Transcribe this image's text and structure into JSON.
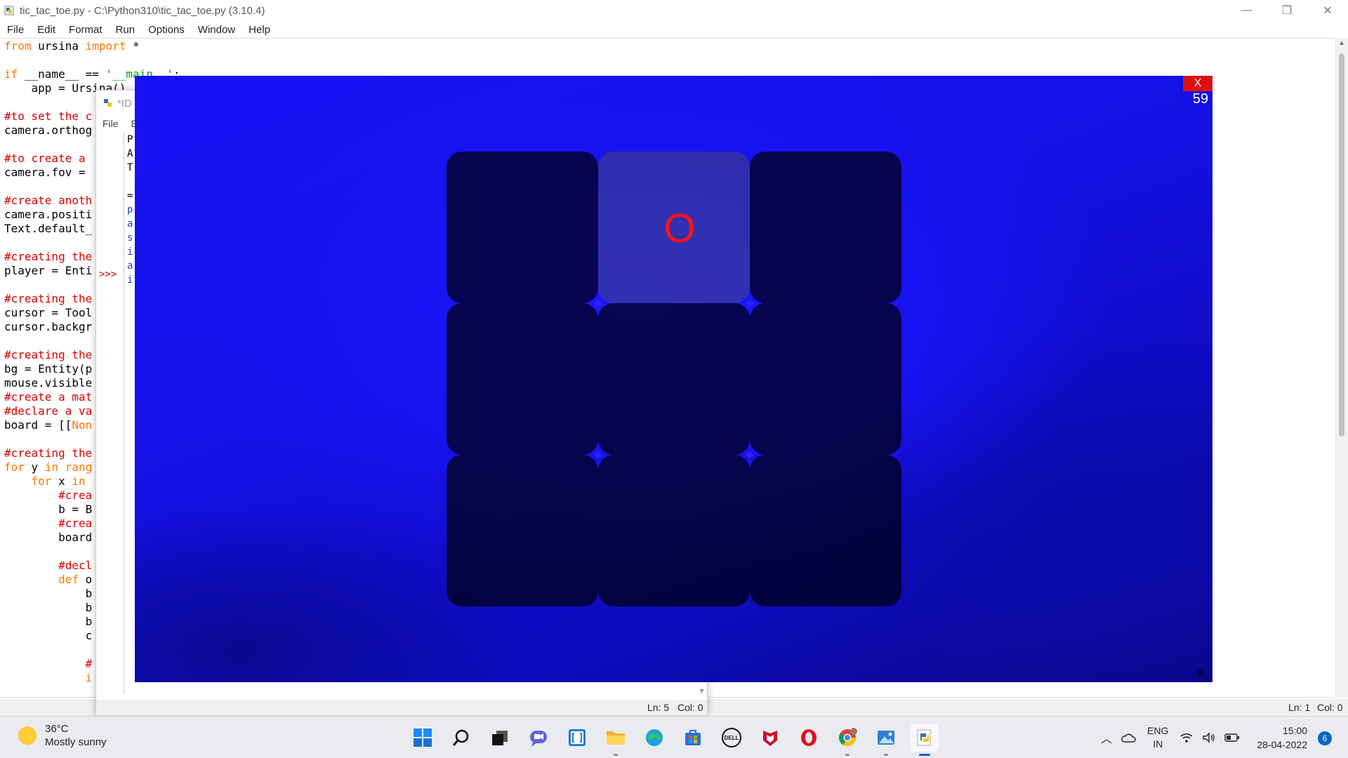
{
  "editor": {
    "title": "tic_tac_toe.py - C:\\Python310\\tic_tac_toe.py (3.10.4)",
    "menu": [
      "File",
      "Edit",
      "Format",
      "Run",
      "Options",
      "Window",
      "Help"
    ],
    "controls": {
      "minimize": "—",
      "restore": "❐",
      "close": "✕"
    },
    "status": {
      "ln": "Ln: 1",
      "col": "Col: 0"
    },
    "code": [
      [
        [
          "kw",
          "from"
        ],
        [
          "tx",
          " ursina "
        ],
        [
          "kw",
          "import"
        ],
        [
          "tx",
          " *"
        ]
      ],
      [],
      [
        [
          "kw",
          "if"
        ],
        [
          "tx",
          " __name__ == "
        ],
        [
          "st",
          "'__main__'"
        ],
        [
          "tx",
          ":"
        ]
      ],
      [
        [
          "tx",
          "    app = Ursina()"
        ]
      ],
      [],
      [
        [
          "cm",
          "#to set the c"
        ]
      ],
      [
        [
          "tx",
          "camera.orthog"
        ]
      ],
      [],
      [
        [
          "cm",
          "#to create a"
        ]
      ],
      [
        [
          "tx",
          "camera.fov ="
        ]
      ],
      [],
      [
        [
          "cm",
          "#create anoth"
        ]
      ],
      [
        [
          "tx",
          "camera.positi"
        ]
      ],
      [
        [
          "tx",
          "Text.default_"
        ]
      ],
      [],
      [
        [
          "cm",
          "#creating the"
        ]
      ],
      [
        [
          "tx",
          "player = Enti"
        ]
      ],
      [],
      [
        [
          "cm",
          "#creating the"
        ]
      ],
      [
        [
          "tx",
          "cursor = Tool"
        ]
      ],
      [
        [
          "tx",
          "cursor.backgr"
        ]
      ],
      [],
      [
        [
          "cm",
          "#creating the"
        ]
      ],
      [
        [
          "tx",
          "bg = Entity(p"
        ]
      ],
      [
        [
          "tx",
          "mouse.visible"
        ]
      ],
      [
        [
          "cm",
          "#create a mat"
        ]
      ],
      [
        [
          "cm",
          "#declare a va"
        ]
      ],
      [
        [
          "tx",
          "board = [["
        ],
        [
          "kw",
          "Non"
        ]
      ],
      [],
      [
        [
          "cm",
          "#creating the"
        ]
      ],
      [
        [
          "kw",
          "for"
        ],
        [
          "tx",
          " y "
        ],
        [
          "kw",
          "in"
        ],
        [
          "tx",
          " "
        ],
        [
          "kw",
          "rang"
        ]
      ],
      [
        [
          "tx",
          "    "
        ],
        [
          "kw",
          "for"
        ],
        [
          "tx",
          " x "
        ],
        [
          "kw",
          "in"
        ]
      ],
      [
        [
          "tx",
          "        "
        ],
        [
          "cm",
          "#crea"
        ]
      ],
      [
        [
          "tx",
          "        b = B"
        ]
      ],
      [
        [
          "tx",
          "        "
        ],
        [
          "cm",
          "#crea"
        ]
      ],
      [
        [
          "tx",
          "        board"
        ]
      ],
      [],
      [
        [
          "tx",
          "        "
        ],
        [
          "cm",
          "#decl"
        ]
      ],
      [
        [
          "tx",
          "        "
        ],
        [
          "kw",
          "def"
        ],
        [
          "tx",
          " o"
        ]
      ],
      [
        [
          "tx",
          "            b"
        ]
      ],
      [
        [
          "tx",
          "            b"
        ]
      ],
      [
        [
          "tx",
          "            b"
        ]
      ],
      [
        [
          "tx",
          "            c"
        ]
      ],
      [],
      [
        [
          "tx",
          "            "
        ],
        [
          "cm",
          "#"
        ]
      ],
      [
        [
          "tx",
          "            "
        ],
        [
          "kw",
          "i"
        ]
      ]
    ]
  },
  "shell": {
    "title": "*ID",
    "menu": [
      "File",
      "E"
    ],
    "prompt": ">>>",
    "lines": [
      {
        "text": "P",
        "color": "black"
      },
      {
        "text": "A",
        "color": "black"
      },
      {
        "text": "T",
        "color": "black"
      },
      {
        "text": "",
        "color": "black"
      },
      {
        "text": "=",
        "color": "black"
      },
      {
        "text": "p",
        "color": "blue"
      },
      {
        "text": "a",
        "color": "blue"
      },
      {
        "text": "s",
        "color": "blue"
      },
      {
        "text": "i",
        "color": "blue"
      },
      {
        "text": "a",
        "color": "blue"
      },
      {
        "text": "i",
        "color": "blue"
      }
    ],
    "status": {
      "ln": "Ln: 5",
      "col": "Col: 0"
    }
  },
  "game": {
    "close_label": "X",
    "fps": "59",
    "board": [
      [
        "",
        "O",
        ""
      ],
      [
        "",
        "",
        ""
      ],
      [
        "",
        "",
        ""
      ]
    ],
    "highlighted_cell": [
      0,
      1
    ],
    "mark_color": "#ff1111",
    "background_color": "#1611f5"
  },
  "taskbar": {
    "weather": {
      "temp": "36°C",
      "desc": "Mostly sunny"
    },
    "apps": [
      {
        "name": "start-button",
        "icon": "windows-icon"
      },
      {
        "name": "search-button",
        "icon": "search-icon"
      },
      {
        "name": "task-view-button",
        "icon": "task-view-icon"
      },
      {
        "name": "teams-chat-button",
        "icon": "teams-chat-icon"
      },
      {
        "name": "brackets-app-button",
        "icon": "brackets-icon"
      },
      {
        "name": "file-explorer-button",
        "icon": "folder-icon"
      },
      {
        "name": "edge-button",
        "icon": "edge-icon"
      },
      {
        "name": "store-button",
        "icon": "store-icon"
      },
      {
        "name": "dell-button",
        "icon": "dell-icon"
      },
      {
        "name": "mcafee-button",
        "icon": "mcafee-icon"
      },
      {
        "name": "opera-button",
        "icon": "opera-icon"
      },
      {
        "name": "chrome-button",
        "icon": "chrome-icon"
      },
      {
        "name": "photos-button",
        "icon": "photos-icon"
      },
      {
        "name": "python-idle-button",
        "icon": "python-icon"
      }
    ],
    "lang": {
      "line1": "ENG",
      "line2": "IN"
    },
    "time": "15:00",
    "date": "28-04-2022",
    "notifications": "6"
  }
}
